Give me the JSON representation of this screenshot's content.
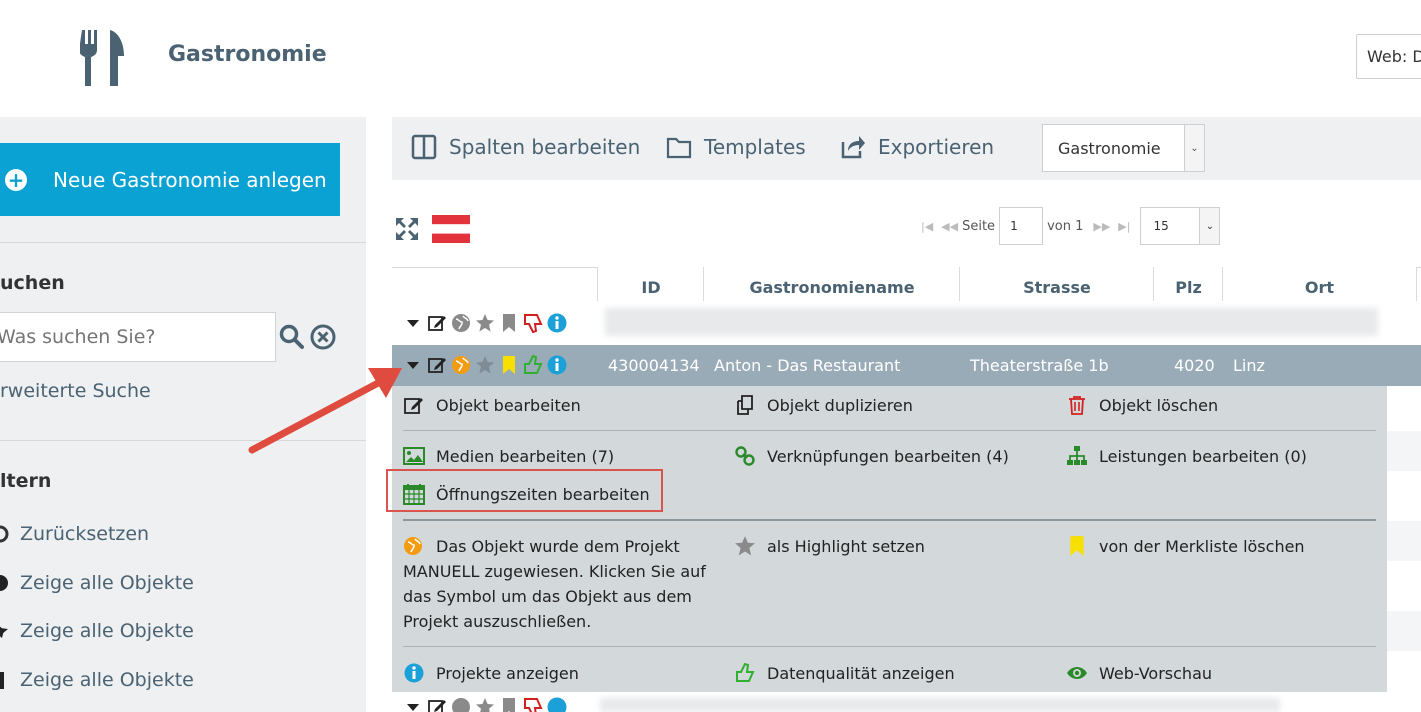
{
  "header": {
    "app_title": "Gastronomie",
    "logo_icon": "cutlery-icon",
    "web_select_value": "Web: D"
  },
  "sidebar": {
    "new_button_label": "Neue Gastronomie anlegen",
    "search_heading": "uchen",
    "search_placeholder": "Was suchen Sie?",
    "advanced_search": "rweiterte Suche",
    "filter_heading": "ltern",
    "filters": [
      {
        "label": "Zurücksetzen",
        "icon": "reset-icon"
      },
      {
        "label": "Zeige alle Objekte",
        "icon": "globe-icon"
      },
      {
        "label": "Zeige alle Objekte",
        "icon": "star-icon"
      },
      {
        "label": "Zeige alle Objekte",
        "icon": "bookmark-icon"
      }
    ]
  },
  "toolbar": {
    "columns_label": "Spalten bearbeiten",
    "templates_label": "Templates",
    "export_label": "Exportieren",
    "category_select": "Gastronomie"
  },
  "pager": {
    "page_label": "Seite",
    "page_value": "1",
    "of_label": "von 1",
    "page_size": "15"
  },
  "table": {
    "columns": [
      "ID",
      "Gastronomiename",
      "Strasse",
      "Plz",
      "Ort"
    ],
    "selected_row": {
      "id": "430004134",
      "name": "Anton - Das Restaurant",
      "street": "Theaterstraße 1b",
      "zip": "4020",
      "city": "Linz"
    }
  },
  "panel": {
    "edit_object": "Objekt bearbeiten",
    "duplicate_object": "Objekt duplizieren",
    "delete_object": "Objekt löschen",
    "edit_media": "Medien bearbeiten (7)",
    "edit_links": "Verknüpfungen bearbeiten (4)",
    "edit_services": "Leistungen bearbeiten (0)",
    "edit_hours": "Öffnungszeiten bearbeiten",
    "project_info": "Das Objekt wurde dem Projekt MANUELL zugewiesen. Klicken Sie auf das Symbol um das Objekt aus dem Projekt auszuschließen.",
    "set_highlight": "als Highlight setzen",
    "remove_bookmark": "von der Merkliste löschen",
    "show_projects": "Projekte anzeigen",
    "show_quality": "Datenqualität anzeigen",
    "web_preview": "Web-Vorschau"
  },
  "colors": {
    "accent": "#0aa2d2",
    "selected_row": "#9aabb8",
    "panel_bg": "#d3d8db",
    "highlight_border": "#d9534f",
    "arrow": "#e04b3f"
  }
}
